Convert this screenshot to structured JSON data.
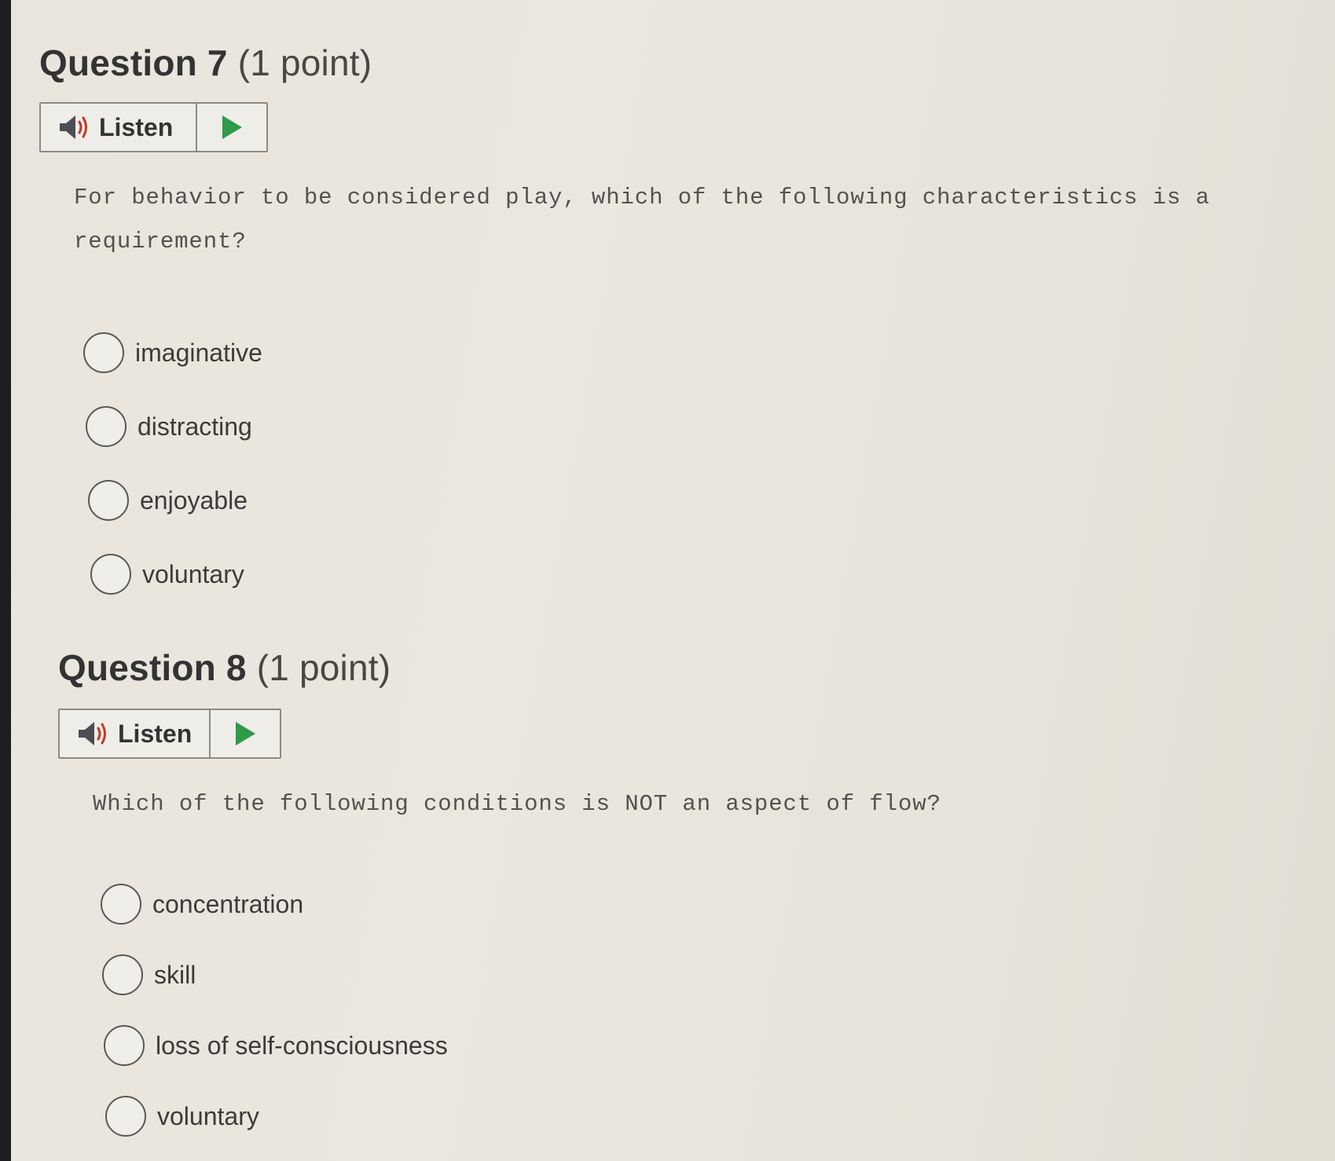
{
  "questions": [
    {
      "number_label": "Question 7",
      "points_label": "(1 point)",
      "listen_label": "Listen",
      "text": "For behavior to be considered play, which of the following characteristics is a requirement?",
      "options": [
        "imaginative",
        "distracting",
        "enjoyable",
        "voluntary"
      ]
    },
    {
      "number_label": "Question 8",
      "points_label": "(1 point)",
      "listen_label": "Listen",
      "text": "Which of the following conditions is NOT an aspect of flow?",
      "options": [
        "concentration",
        "skill",
        "loss of self-consciousness",
        "voluntary"
      ]
    }
  ],
  "icons": {
    "speaker": "speaker-icon",
    "play": "play-icon",
    "radio": "radio-unselected"
  },
  "colors": {
    "play_green": "#2e9a4a",
    "speaker_gray": "#4d4d55",
    "speaker_waves": "#c0392b"
  }
}
